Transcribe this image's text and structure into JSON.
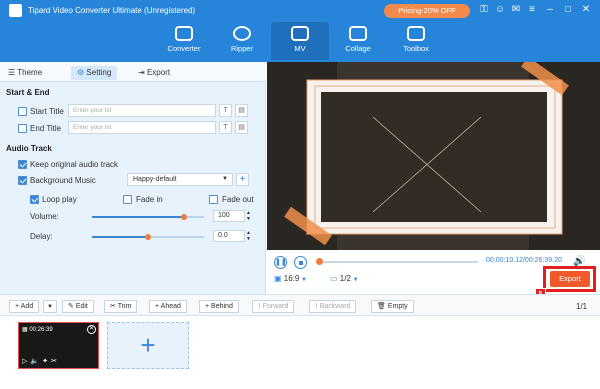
{
  "app": {
    "title": "Tipard Video Converter Ultimate (Unregistered)",
    "promo": "Pricing-20% OFF"
  },
  "nav": [
    {
      "label": "Converter"
    },
    {
      "label": "Ripper"
    },
    {
      "label": "MV"
    },
    {
      "label": "Collage"
    },
    {
      "label": "Toolbox"
    }
  ],
  "tabs": {
    "theme": "Theme",
    "setting": "Setting",
    "export": "Export"
  },
  "start_end": {
    "heading": "Start & End",
    "start_title": "Start Title",
    "end_title": "End Title",
    "placeholder": "Enter your txt"
  },
  "audio": {
    "heading": "Audio Track",
    "keep_original": "Keep original audio track",
    "background_music": "Background Music",
    "music_value": "Happy-default",
    "loop_play": "Loop play",
    "fade_in": "Fade in",
    "fade_out": "Fade out",
    "volume_label": "Volume:",
    "volume_value": "100",
    "volume_level": 0.82,
    "delay_label": "Delay:",
    "delay_value": "0.0",
    "delay_level": 0.5
  },
  "player": {
    "time": "00:00:10.12/00:26:39.20",
    "aspect": "16:9",
    "page": "1/2",
    "export": "Export",
    "step": "5"
  },
  "toolbar": {
    "add": "Add",
    "edit": "Edit",
    "trim": "Trim",
    "ahead": "Ahead",
    "behind": "Behind",
    "forward": "Forward",
    "backward": "Backward",
    "empty": "Empty",
    "page": "1/1"
  },
  "clip": {
    "duration": "00:26:39"
  }
}
